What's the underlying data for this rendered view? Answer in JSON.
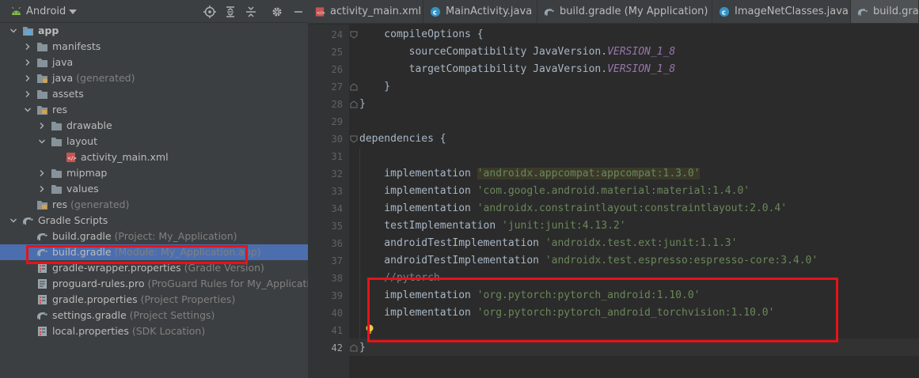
{
  "project_panel": {
    "view_mode": "Android",
    "tree": [
      {
        "label": "app",
        "hint": "",
        "indent": 0,
        "chevron": "open",
        "icon": "module-folder-icon",
        "bold": true
      },
      {
        "label": "manifests",
        "hint": "",
        "indent": 1,
        "chevron": "closed",
        "icon": "folder-icon",
        "bold": false
      },
      {
        "label": "java",
        "hint": "",
        "indent": 1,
        "chevron": "closed",
        "icon": "folder-icon",
        "bold": false
      },
      {
        "label": "java",
        "hint": "(generated)",
        "indent": 1,
        "chevron": "closed",
        "icon": "generated-folder-icon",
        "bold": false
      },
      {
        "label": "assets",
        "hint": "",
        "indent": 1,
        "chevron": "closed",
        "icon": "folder-icon",
        "bold": false
      },
      {
        "label": "res",
        "hint": "",
        "indent": 1,
        "chevron": "open",
        "icon": "res-folder-icon",
        "bold": false
      },
      {
        "label": "drawable",
        "hint": "",
        "indent": 2,
        "chevron": "closed",
        "icon": "folder-icon",
        "bold": false
      },
      {
        "label": "layout",
        "hint": "",
        "indent": 2,
        "chevron": "open",
        "icon": "folder-icon",
        "bold": false
      },
      {
        "label": "activity_main.xml",
        "hint": "",
        "indent": 3,
        "chevron": "none",
        "icon": "xml-file-icon",
        "bold": false
      },
      {
        "label": "mipmap",
        "hint": "",
        "indent": 2,
        "chevron": "closed",
        "icon": "folder-icon",
        "bold": false
      },
      {
        "label": "values",
        "hint": "",
        "indent": 2,
        "chevron": "closed",
        "icon": "folder-icon",
        "bold": false
      },
      {
        "label": "res",
        "hint": "(generated)",
        "indent": 1,
        "chevron": "none",
        "icon": "res-folder-icon",
        "bold": false
      },
      {
        "label": "Gradle Scripts",
        "hint": "",
        "indent": 0,
        "chevron": "open",
        "icon": "gradle-icon",
        "bold": false
      },
      {
        "label": "build.gradle",
        "hint": "(Project: My_Application)",
        "indent": 1,
        "chevron": "none",
        "icon": "gradle-icon",
        "bold": false
      },
      {
        "label": "build.gradle",
        "hint": "(Module: My_Application.app)",
        "indent": 1,
        "chevron": "none",
        "icon": "gradle-icon",
        "bold": false,
        "selected": true
      },
      {
        "label": "gradle-wrapper.properties",
        "hint": "(Gradle Version)",
        "indent": 1,
        "chevron": "none",
        "icon": "properties-file-icon",
        "bold": false
      },
      {
        "label": "proguard-rules.pro",
        "hint": "(ProGuard Rules for My_Application",
        "indent": 1,
        "chevron": "none",
        "icon": "text-file-icon",
        "bold": false
      },
      {
        "label": "gradle.properties",
        "hint": "(Project Properties)",
        "indent": 1,
        "chevron": "none",
        "icon": "properties-file-icon",
        "bold": false
      },
      {
        "label": "settings.gradle",
        "hint": "(Project Settings)",
        "indent": 1,
        "chevron": "none",
        "icon": "gradle-icon",
        "bold": false
      },
      {
        "label": "local.properties",
        "hint": "(SDK Location)",
        "indent": 1,
        "chevron": "none",
        "icon": "properties-file-icon",
        "bold": false
      }
    ]
  },
  "tabs": [
    {
      "label": "activity_main.xml",
      "icon": "xml-file-icon",
      "active": false
    },
    {
      "label": "MainActivity.java",
      "icon": "java-class-icon",
      "active": false
    },
    {
      "label": "build.gradle (My Application)",
      "icon": "gradle-icon",
      "active": false
    },
    {
      "label": "ImageNetClasses.java",
      "icon": "java-class-icon",
      "active": false
    },
    {
      "label": "build.grad",
      "icon": "gradle-icon",
      "active": true
    }
  ],
  "editor": {
    "current_line": 42,
    "lines": [
      {
        "n": 24,
        "segs": [
          {
            "t": "    compileOptions {",
            "c": "plain"
          }
        ]
      },
      {
        "n": 25,
        "segs": [
          {
            "t": "        sourceCompatibility JavaVersion.",
            "c": "plain"
          },
          {
            "t": "VERSION_1_8",
            "c": "const"
          }
        ]
      },
      {
        "n": 26,
        "segs": [
          {
            "t": "        targetCompatibility JavaVersion.",
            "c": "plain"
          },
          {
            "t": "VERSION_1_8",
            "c": "const"
          }
        ]
      },
      {
        "n": 27,
        "segs": [
          {
            "t": "    }",
            "c": "plain"
          }
        ]
      },
      {
        "n": 28,
        "segs": [
          {
            "t": "}",
            "c": "plain"
          }
        ]
      },
      {
        "n": 29,
        "segs": []
      },
      {
        "n": 30,
        "segs": [
          {
            "t": "dependencies ",
            "c": "plain"
          },
          {
            "t": "{",
            "c": "plain"
          }
        ]
      },
      {
        "n": 31,
        "segs": []
      },
      {
        "n": 32,
        "segs": [
          {
            "t": "    implementation ",
            "c": "plain"
          },
          {
            "t": "'androidx.appcompat:appcompat:1.3.0'",
            "c": "str-hl"
          }
        ]
      },
      {
        "n": 33,
        "segs": [
          {
            "t": "    implementation ",
            "c": "plain"
          },
          {
            "t": "'com.google.android.material:material:1.4.0'",
            "c": "str"
          }
        ]
      },
      {
        "n": 34,
        "segs": [
          {
            "t": "    implementation ",
            "c": "plain"
          },
          {
            "t": "'androidx.constraintlayout:constraintlayout:2.0.4'",
            "c": "str"
          }
        ]
      },
      {
        "n": 35,
        "segs": [
          {
            "t": "    testImplementation ",
            "c": "plain"
          },
          {
            "t": "'junit:junit:4.13.2'",
            "c": "str"
          }
        ]
      },
      {
        "n": 36,
        "segs": [
          {
            "t": "    androidTestImplementation ",
            "c": "plain"
          },
          {
            "t": "'androidx.test.ext:junit:1.1.3'",
            "c": "str"
          }
        ]
      },
      {
        "n": 37,
        "segs": [
          {
            "t": "    androidTestImplementation ",
            "c": "plain"
          },
          {
            "t": "'androidx.test.espresso:espresso-core:3.4.0'",
            "c": "str"
          }
        ]
      },
      {
        "n": 38,
        "segs": [
          {
            "t": "    //pytorch",
            "c": "cmt"
          }
        ]
      },
      {
        "n": 39,
        "segs": [
          {
            "t": "    implementation ",
            "c": "plain"
          },
          {
            "t": "'org.pytorch:pytorch_android:1.10.0'",
            "c": "str"
          }
        ]
      },
      {
        "n": 40,
        "segs": [
          {
            "t": "    implementation ",
            "c": "plain"
          },
          {
            "t": "'org.pytorch:pytorch_android_torchvision:1.10.0'",
            "c": "str"
          }
        ]
      },
      {
        "n": 41,
        "segs": []
      },
      {
        "n": 42,
        "segs": [
          {
            "t": "}",
            "c": "plain"
          }
        ]
      }
    ]
  },
  "colors": {
    "selection": "#4b6eaf",
    "annotation_red": "#e5141a",
    "string": "#6a8759",
    "constant": "#9876aa"
  }
}
